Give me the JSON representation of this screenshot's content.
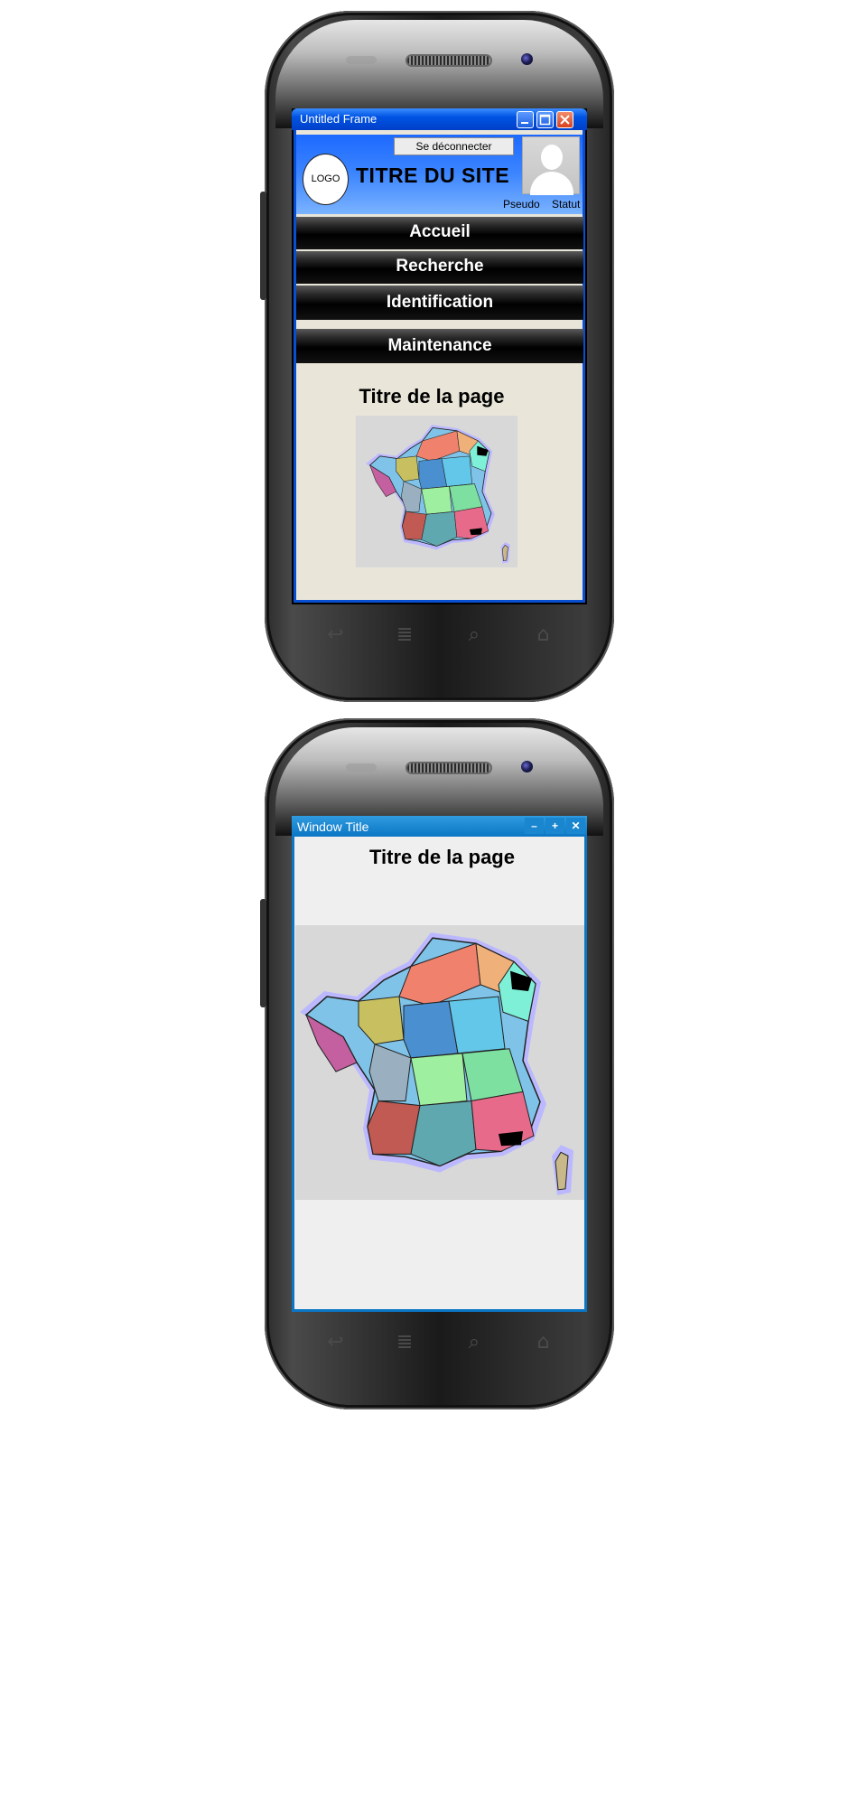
{
  "phone1": {
    "window": {
      "title": "Untitled Frame",
      "min_icon": "minimize-icon",
      "max_icon": "maximize-icon",
      "close_icon": "close-icon"
    },
    "header": {
      "logout_button": "Se déconnecter",
      "logo_text": "LOGO",
      "site_title": "TITRE DU SITE",
      "pseudo_label": "Pseudo",
      "status_label": "Statut"
    },
    "menu": [
      {
        "label": "Accueil"
      },
      {
        "label": "Recherche"
      },
      {
        "label": "Identification"
      },
      {
        "label": "Maintenance"
      }
    ],
    "content": {
      "page_title": "Titre de la page"
    }
  },
  "phone2": {
    "window": {
      "title": "Window Title",
      "min_glyph": "–",
      "max_glyph": "+",
      "close_glyph": "✕"
    },
    "content": {
      "page_title": "Titre de la page"
    }
  },
  "hardware_keys": [
    "back-icon",
    "menu-icon",
    "search-icon",
    "home-icon"
  ],
  "colors": {
    "xp_blue": "#0053e3",
    "flat_blue": "#0b76c4",
    "content_bg_1": "#e9e6d9",
    "content_bg_2": "#efefef"
  }
}
